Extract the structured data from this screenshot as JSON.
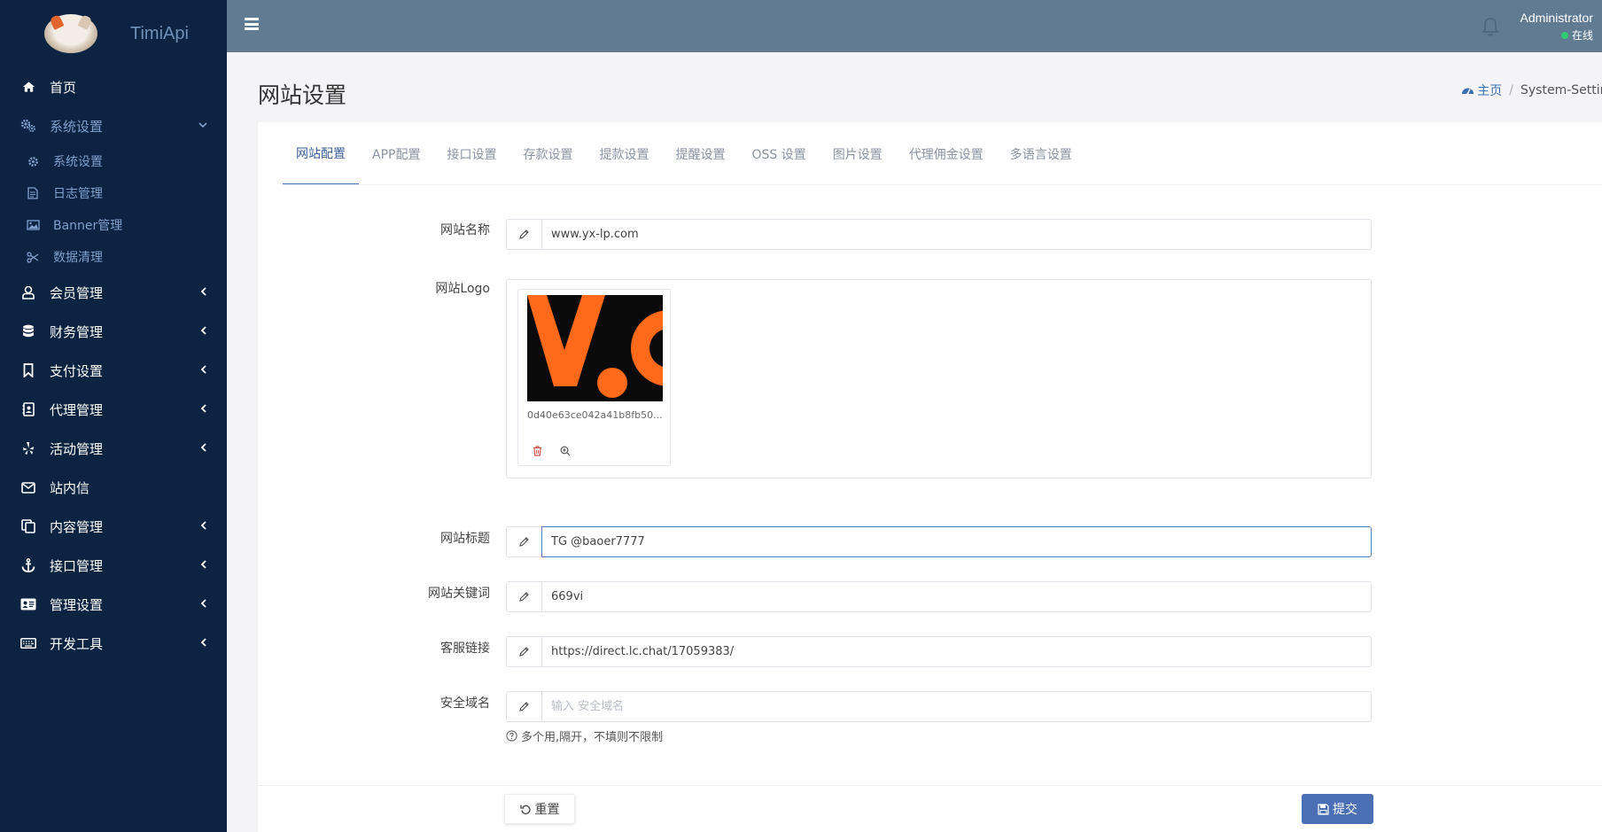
{
  "brand": {
    "name": "TimiApi"
  },
  "header": {
    "user_name": "Administrator",
    "user_status": "在线"
  },
  "sidebar": {
    "items": [
      {
        "label": "首页",
        "icon": "home-icon"
      },
      {
        "label": "系统设置",
        "icon": "gears-icon",
        "expanded": true
      },
      {
        "label": "会员管理",
        "icon": "user-icon"
      },
      {
        "label": "财务管理",
        "icon": "database-icon"
      },
      {
        "label": "支付设置",
        "icon": "bookmark-icon"
      },
      {
        "label": "代理管理",
        "icon": "contact-icon"
      },
      {
        "label": "活动管理",
        "icon": "yelp-icon"
      },
      {
        "label": "站内信",
        "icon": "envelope-icon"
      },
      {
        "label": "内容管理",
        "icon": "copy-icon"
      },
      {
        "label": "接口管理",
        "icon": "anchor-icon"
      },
      {
        "label": "管理设置",
        "icon": "id-card-icon"
      },
      {
        "label": "开发工具",
        "icon": "keyboard-icon"
      }
    ],
    "sub_items": [
      {
        "label": "系统设置",
        "icon": "gear-icon"
      },
      {
        "label": "日志管理",
        "icon": "file-icon"
      },
      {
        "label": "Banner管理",
        "icon": "image-icon"
      },
      {
        "label": "数据清理",
        "icon": "scissors-icon"
      }
    ]
  },
  "page": {
    "title": "网站设置",
    "breadcrumb_home": "主页",
    "breadcrumb_current": "System-Setting"
  },
  "tabs": [
    "网站配置",
    "APP配置",
    "接口设置",
    "存款设置",
    "提款设置",
    "提醒设置",
    "OSS 设置",
    "图片设置",
    "代理佣金设置",
    "多语言设置"
  ],
  "form": {
    "site_name": {
      "label": "网站名称",
      "value": "www.yx-lp.com"
    },
    "site_logo": {
      "label": "网站Logo",
      "file_name": "0d40e63ce042a41b8fb50...",
      "image_text": "V."
    },
    "site_title": {
      "label": "网站标题",
      "value": "TG @baoer7777"
    },
    "site_keywords": {
      "label": "网站关键词",
      "value": "669vi"
    },
    "service_link": {
      "label": "客服链接",
      "value": "https://direct.lc.chat/17059383/"
    },
    "safe_domain": {
      "label": "安全域名",
      "value": "",
      "placeholder": "输入 安全域名",
      "help": "多个用,隔开，不填则不限制"
    }
  },
  "buttons": {
    "reset": "重置",
    "submit": "提交"
  },
  "colors": {
    "sidebar_bg": "#0c2342",
    "topbar_bg": "#617b93",
    "accent": "#4a6fb5",
    "logo_orange": "#ff6a1a"
  }
}
